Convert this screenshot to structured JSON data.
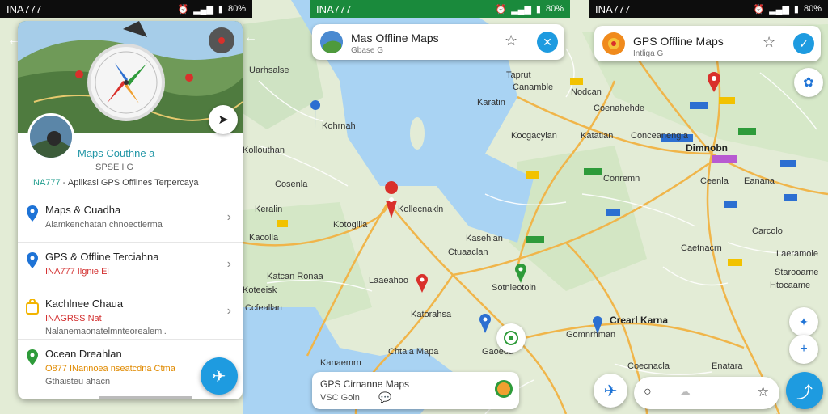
{
  "status_bars": [
    {
      "carrier": "INA777",
      "battery": "80%"
    },
    {
      "carrier": "INA777",
      "battery": "80%"
    },
    {
      "carrier": "INA777",
      "battery": "80%"
    }
  ],
  "left_panel": {
    "place_name": "Maps Couthne a",
    "place_sub": "SPSE I  G",
    "tagline_brand": "INA777",
    "tagline_rest": " - Aplikasi GPS Offlines Terpercaya",
    "items": [
      {
        "title": "Maps & Cuadha",
        "subtitle": "Alamkenchatan chnoectierma",
        "icon_color": "#1e73d6",
        "subtitle_style": "normal"
      },
      {
        "title": "GPS & Offline Terciahna",
        "subtitle": "INA777  Ilgnie  El",
        "icon_color": "#1e73d6",
        "subtitle_style": "red"
      },
      {
        "title": "Kachlnee Chaua",
        "subtitle": "INAGRSS  Nat",
        "subtitle2": "Nalanemaonatelmnteorealeml.",
        "icon_color": "#f2b400",
        "subtitle_style": "red"
      },
      {
        "title": "Ocean Dreahlan",
        "subtitle": "O877  INannoea nseatcdna Ctma",
        "subtitle2": "Gthaisteu ahacn",
        "icon_color": "#2e9b3a",
        "subtitle_style": "orange"
      }
    ]
  },
  "center_search": {
    "title": "Mas Offline Maps",
    "subtitle": "Gbase  G"
  },
  "center_bottom_card": {
    "title": "GPS Cirnanne Maps",
    "subtitle": "VSC  Goln"
  },
  "right_search": {
    "title": "GPS Offline Maps",
    "subtitle": "Intliga  G"
  },
  "map_labels": {
    "uarhsalse": "Uarhsalse",
    "kohrnah": "Kohrnah",
    "kolloutran": "Kollouthan",
    "cosenla": "Cosenla",
    "keralin": "Keralin",
    "kotogllla": "Kotogllla",
    "kacolla": "Kacolla",
    "katcan_ronaa": "Katcan Ronaa",
    "koteeisk": "Koteeisk",
    "ccfeallan": "Ccfeallan",
    "kollecnakln": "Kollecnakln",
    "kasehlan": "Kasehlan",
    "ctuaaclan": "Ctuaaclan",
    "laaeahoo": "Laaeahoo",
    "sotnieotoln": "Sotnieotoln",
    "katorahsa": "Katorahsa",
    "kanazera": "Kanaemrn",
    "chtala_mapa": "Chtala Mapa",
    "gaoeda": "Gaoeda",
    "tapruh": "Taprut",
    "canamble": "Canamble",
    "nodcan": "Nodcan",
    "keratin": "Karatin",
    "coenahehde": "Coenahehde",
    "kocgacyian": "Kocgacyian",
    "katatlan": "Katatlan",
    "conceanenga": "Conceanengla",
    "otecla_comb": "Dimnobn",
    "cotmelp": "Conremn",
    "ceenla": "Ceenla",
    "eanana": "Eanana",
    "carcole": "Carcolo",
    "caetnacrn": "Caetnacrn",
    "staroaorne": "Starooarne",
    "htocaame": "Htocaame",
    "creatarma": "Crearl Karna",
    "gomnrhman": "Gomnrhman",
    "coecnacla": "Coecnacla",
    "enatara": "Enatara",
    "laecmoie": "Laeramoie"
  },
  "colors": {
    "water": "#a9d3f3",
    "land": "#e3ecd6",
    "road_major": "#f0b54a",
    "road_minor": "#ffffff",
    "accent_blue": "#1e9be0",
    "pin_red": "#d9302b",
    "pin_green": "#2e9b3a"
  },
  "icons": [
    "back-arrow-icon",
    "compass-icon",
    "directions-icon",
    "navigate-icon",
    "pin-icon",
    "check-icon",
    "close-icon",
    "star-icon",
    "location-icon",
    "layers-icon",
    "add-icon"
  ]
}
